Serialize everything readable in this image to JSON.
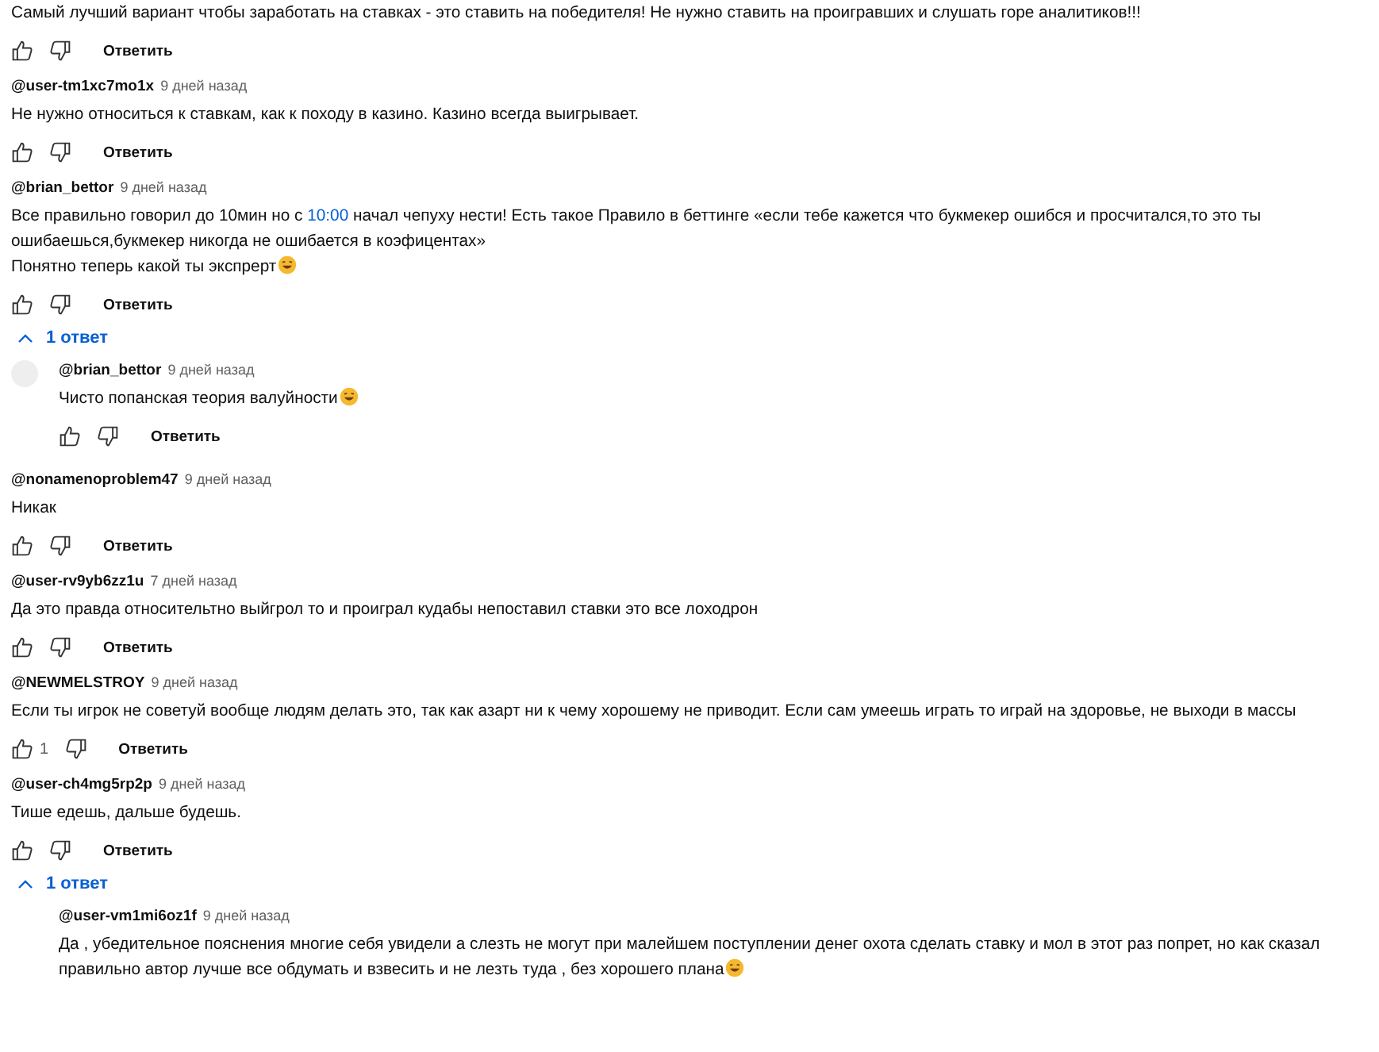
{
  "comments": [
    {
      "body": [
        [
          {
            "kind": "plain",
            "text": "Самый лучший вариант чтобы заработать на ставках - это ставить на победителя! Не нужно ставить на проигравших и слушать горе аналитиков!!!"
          }
        ]
      ],
      "trailing_icon": false,
      "reply_label": "Ответить"
    },
    {
      "author": "@user-tm1xc7mo1x",
      "time": "9 дней назад",
      "body": [
        [
          {
            "kind": "plain",
            "text": "Не нужно относиться к ставкам, как к походу в казино. Казино всегда выигрывает."
          }
        ]
      ],
      "trailing_icon": false,
      "reply_label": "Ответить"
    },
    {
      "author": "@brian_bettor",
      "time": "9 дней назад",
      "body": [
        [
          {
            "kind": "plain",
            "text": "Все правильно говорил до 10мин но с "
          },
          {
            "kind": "timestamp",
            "text": "10:00"
          },
          {
            "kind": "plain",
            "text": " начал чепуху нести! Есть такое Правило в беттинге «если тебе кажется что букмекер ошибся и просчитался,то это ты ошибаешься,букмекер никогда не ошибается в коэфицентах»"
          }
        ],
        [
          {
            "kind": "plain",
            "text": "Понятно теперь какой ты экспрерт"
          }
        ]
      ],
      "trailing_icon": true,
      "reply_label": "Ответить",
      "replies_toggle": {
        "label": "1 ответ",
        "expanded": true
      },
      "replies": [
        {
          "author": "@brian_bettor",
          "time": "9 дней назад",
          "avatar": true,
          "body": [
            [
              {
                "kind": "plain",
                "text": "Чисто попанская теория валуйности"
              }
            ]
          ],
          "trailing_icon": true,
          "reply_label": "Ответить"
        }
      ]
    },
    {
      "author": "@nonamenoproblem47",
      "time": "9 дней назад",
      "body": [
        [
          {
            "kind": "plain",
            "text": "Никак"
          }
        ]
      ],
      "trailing_icon": false,
      "reply_label": "Ответить"
    },
    {
      "author": "@user-rv9yb6zz1u",
      "time": "7 дней назад",
      "body": [
        [
          {
            "kind": "plain",
            "text": "Да это правда относительтно выйгрол то и проиграл кудабы непоставил ставки это все лоходрон"
          }
        ]
      ],
      "trailing_icon": false,
      "reply_label": "Ответить"
    },
    {
      "author": "@NEWMELSTROY",
      "time": "9 дней назад",
      "body": [
        [
          {
            "kind": "plain",
            "text": "Если ты игрок не советуй вообще людям делать это, так как азарт ни к чему хорошему не приводит. Если сам умеешь играть то играй на здоровье, не выходи в массы"
          }
        ]
      ],
      "trailing_icon": false,
      "likes": "1",
      "reply_label": "Ответить"
    },
    {
      "author": "@user-ch4mg5rp2p",
      "time": "9 дней назад",
      "body": [
        [
          {
            "kind": "plain",
            "text": "Тише едешь, дальше будешь."
          }
        ]
      ],
      "trailing_icon": false,
      "reply_label": "Ответить",
      "replies_toggle": {
        "label": "1 ответ",
        "expanded": true
      },
      "replies": [
        {
          "author": "@user-vm1mi6oz1f",
          "time": "9 дней назад",
          "avatar": false,
          "body": [
            [
              {
                "kind": "plain",
                "text": "Да , убедительное пояснения     многие себя увидели а слезть не могут при малейшем поступлении денег охота сделать ставку и  мол в этот раз попрет, но как сказал правильно автор лучше все обдумать и взвесить и не лезть туда , без хорошего плана"
              }
            ]
          ],
          "trailing_icon": true
        }
      ]
    }
  ]
}
